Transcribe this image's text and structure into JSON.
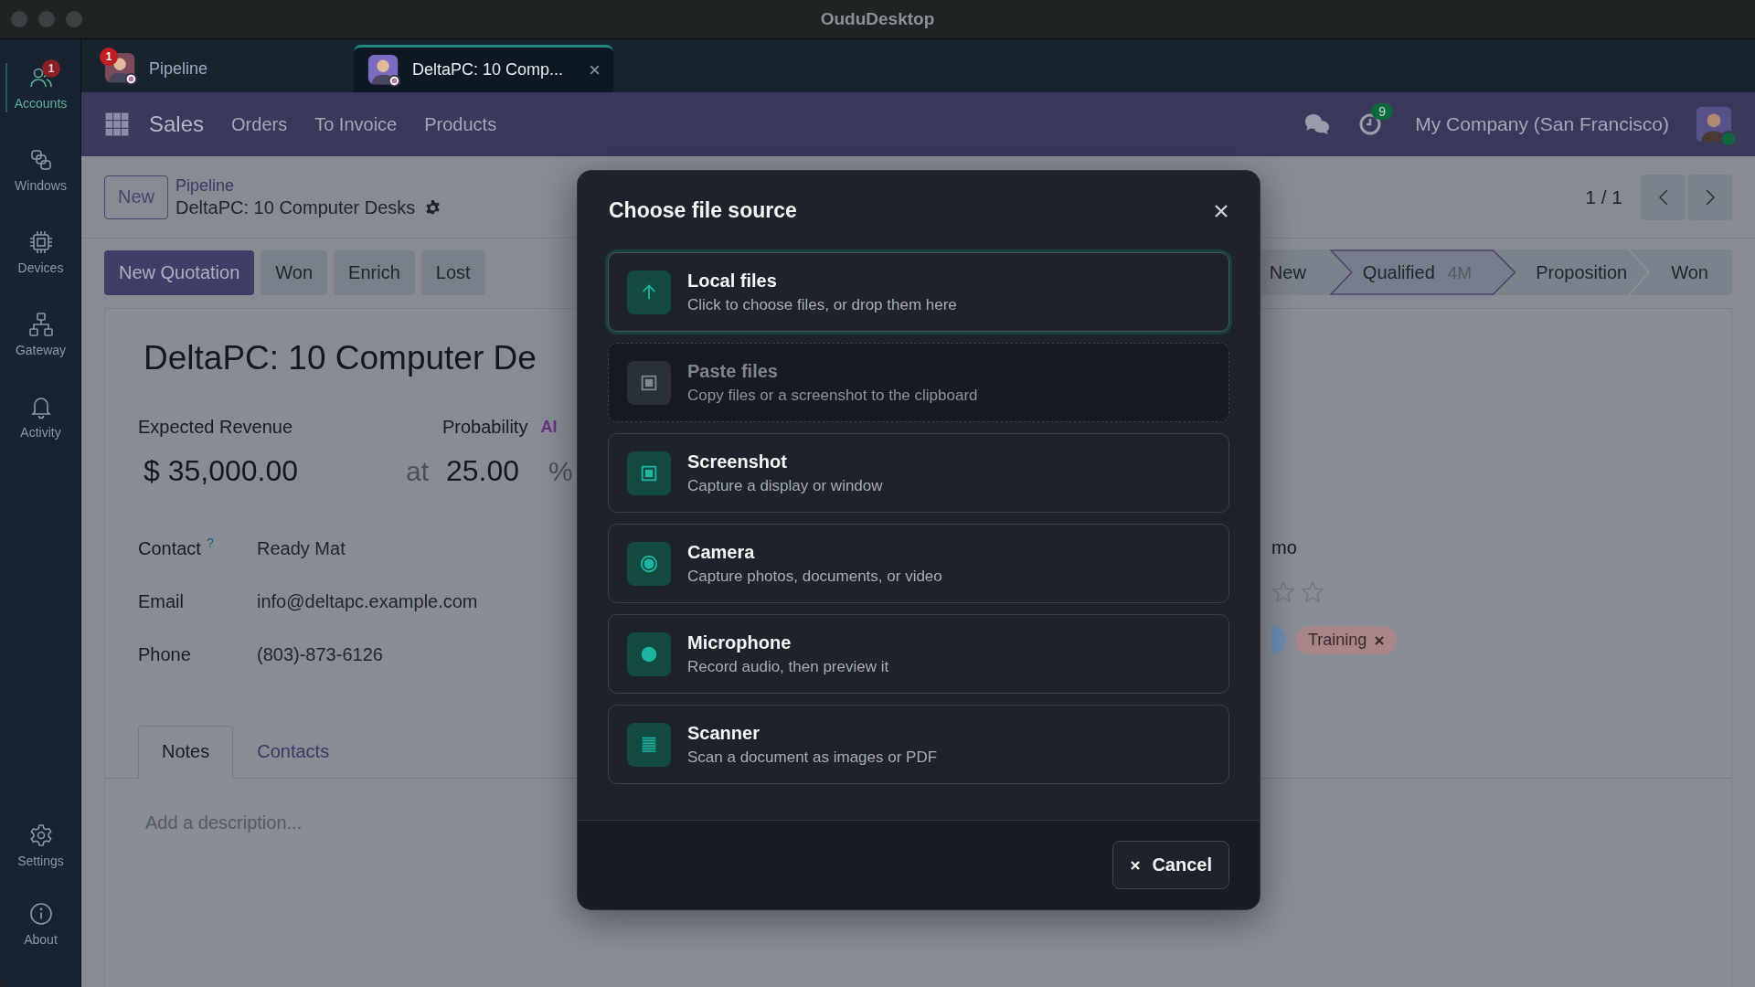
{
  "window": {
    "title": "OuduDesktop"
  },
  "sidebar": {
    "items": [
      {
        "label": "Accounts",
        "kind": "accounts",
        "selected": true,
        "badge": "1"
      },
      {
        "label": "Windows",
        "kind": "windows",
        "selected": false
      },
      {
        "label": "Devices",
        "kind": "devices",
        "selected": false
      },
      {
        "label": "Gateway",
        "kind": "gateway",
        "selected": false
      },
      {
        "label": "Activity",
        "kind": "activity",
        "selected": false
      }
    ],
    "bottom_items": [
      {
        "label": "Settings",
        "kind": "settings",
        "selected": false
      },
      {
        "label": "About",
        "kind": "about",
        "selected": false
      }
    ]
  },
  "tabs": [
    {
      "label": "Pipeline",
      "badge": "1",
      "selected": false,
      "closable": false
    },
    {
      "label": "DeltaPC: 10 Comp...",
      "selected": true,
      "closable": true
    }
  ],
  "navbar": {
    "app": "Sales",
    "menu": [
      "Orders",
      "To Invoice",
      "Products"
    ],
    "activity_count": "9",
    "company": "My Company (San Francisco)",
    "online": true
  },
  "control_panel": {
    "new_button": "New",
    "breadcrumb": "Pipeline",
    "record": "DeltaPC: 10 Computer Desks",
    "pager": "1 / 1"
  },
  "actions": [
    {
      "label": "New Quotation",
      "kind": "primary"
    },
    {
      "label": "Won",
      "kind": "secondary"
    },
    {
      "label": "Enrich",
      "kind": "secondary"
    },
    {
      "label": "Lost",
      "kind": "secondary"
    }
  ],
  "stages": [
    {
      "label": "New",
      "selected": false
    },
    {
      "label": "Qualified",
      "selected": true,
      "note": "4M"
    },
    {
      "label": "Proposition",
      "selected": false
    },
    {
      "label": "Won",
      "selected": false
    }
  ],
  "form": {
    "title": "DeltaPC: 10 Computer De",
    "revenue_label": "Expected Revenue",
    "revenue": "$ 35,000.00",
    "probability_label": "Probability",
    "ai_badge": "AI",
    "probability_at": "at",
    "probability": "25.00",
    "percent": "%",
    "fields": [
      {
        "label": "Contact",
        "help": "?",
        "value": "Ready Mat"
      },
      {
        "label": "Email",
        "value": "info@deltapc.example.com"
      },
      {
        "label": "Phone",
        "value": "(803)-873-6126"
      }
    ],
    "right_fragment": "mo",
    "tags": [
      {
        "color": "#6b8db3"
      },
      {
        "label": "Training",
        "color": "#a88587"
      }
    ],
    "notebook_tabs": [
      {
        "label": "Notes",
        "selected": true
      },
      {
        "label": "Contacts",
        "selected": false
      }
    ],
    "description": {
      "placeholder": "Add a description..."
    }
  },
  "dialog": {
    "title": "Choose file source",
    "cancel": "Cancel",
    "options": [
      {
        "kind": "upload",
        "title": "Local files",
        "description": "Click to choose files, or drop them here",
        "selected": true,
        "disabled": false
      },
      {
        "kind": "paste",
        "title": "Paste files",
        "description": "Copy files or a screenshot to the clipboard",
        "selected": false,
        "disabled": true
      },
      {
        "kind": "screenshot",
        "title": "Screenshot",
        "description": "Capture a display or window",
        "selected": false,
        "disabled": false
      },
      {
        "kind": "camera",
        "title": "Camera",
        "description": "Capture photos, documents, or video",
        "selected": false,
        "disabled": false
      },
      {
        "kind": "microphone",
        "title": "Microphone",
        "description": "Record audio, then preview it",
        "selected": false,
        "disabled": false
      },
      {
        "kind": "scanner",
        "title": "Scanner",
        "description": "Scan a document as images or PDF",
        "selected": false,
        "disabled": false
      }
    ]
  }
}
